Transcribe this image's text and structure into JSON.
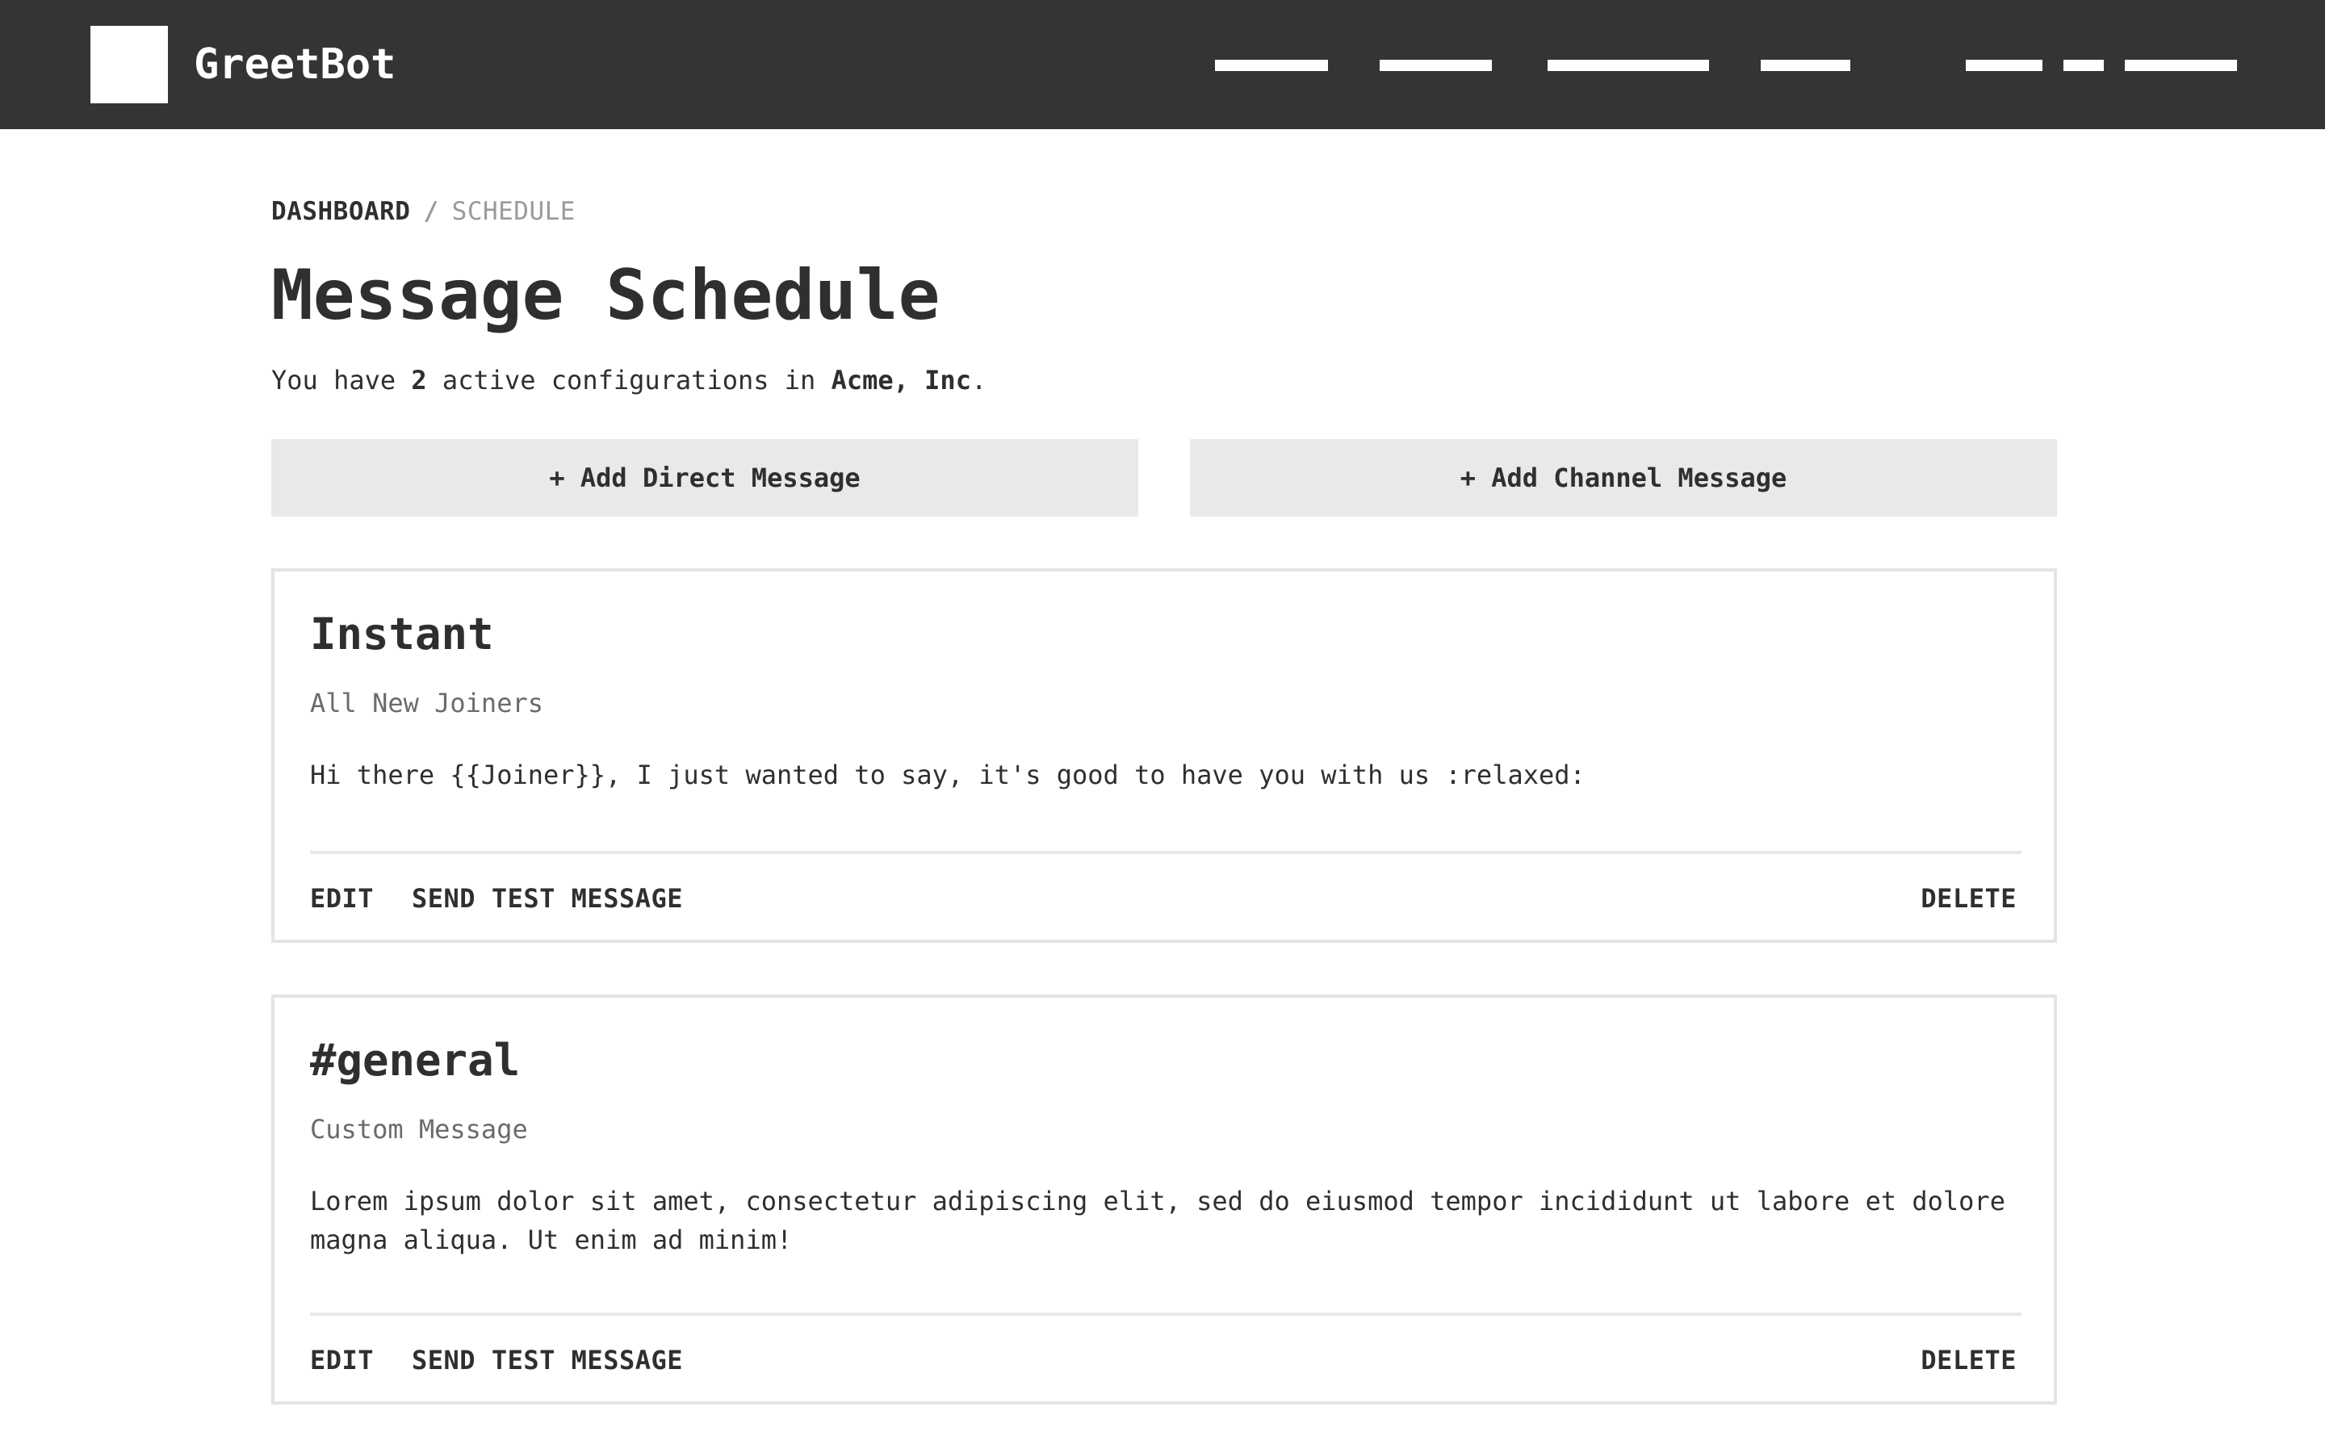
{
  "app": {
    "brand": "GreetBot"
  },
  "breadcrumb": {
    "home": "DASHBOARD",
    "separator": "/",
    "current": "SCHEDULE"
  },
  "page": {
    "title": "Message Schedule",
    "summary_prefix": "You have",
    "active_count": "2",
    "summary_middle": "active configurations in",
    "workspace": "Acme, Inc",
    "summary_suffix": "."
  },
  "actions": {
    "add_direct": "+ Add Direct Message",
    "add_channel": "+ Add Channel Message"
  },
  "cards": [
    {
      "title": "Instant",
      "subtitle": "All New Joiners",
      "body": "Hi there {{Joiner}}, I just wanted to say, it's good to have you with us :relaxed:",
      "edit": "EDIT",
      "test": "SEND TEST MESSAGE",
      "delete": "DELETE"
    },
    {
      "title": "#general",
      "subtitle": "Custom Message",
      "body": "Lorem ipsum dolor sit amet, consectetur adipiscing elit, sed do eiusmod tempor incididunt ut labore et dolore magna aliqua. Ut enim ad minim!",
      "edit": "EDIT",
      "test": "SEND TEST MESSAGE",
      "delete": "DELETE"
    }
  ],
  "colors": {
    "topbar": "#343434",
    "button_bg": "#e9e9e9",
    "card_border": "#e4e4e4",
    "muted_text": "#9a9a9a"
  }
}
